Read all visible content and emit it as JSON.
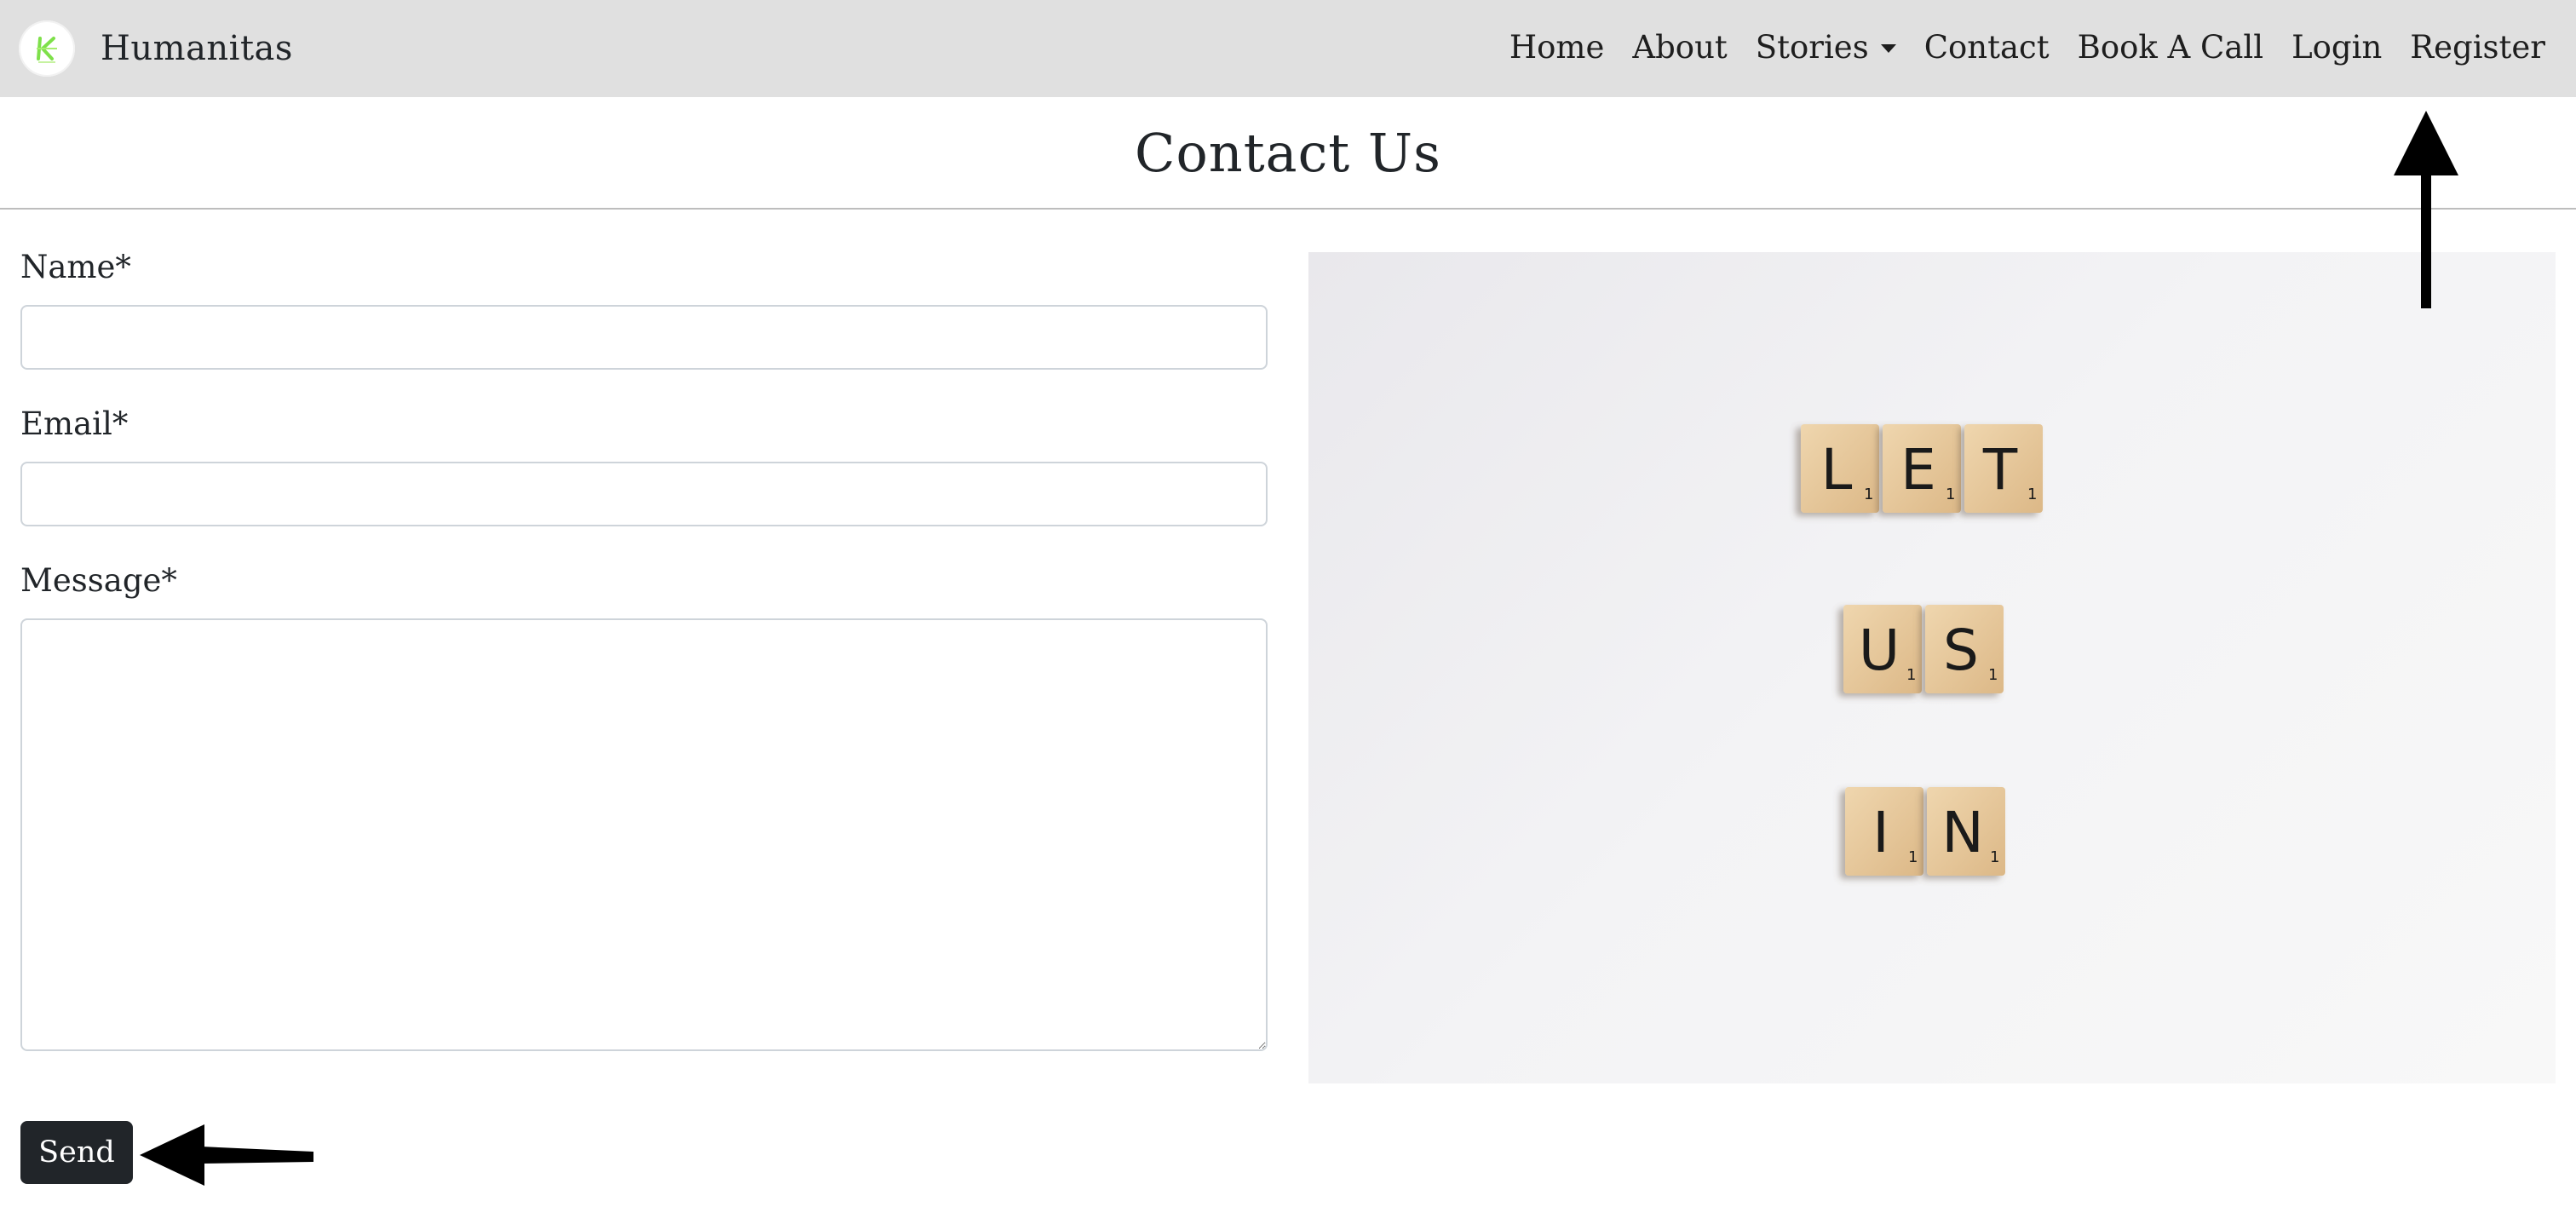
{
  "navbar": {
    "brand_name": "Humanitas",
    "logo_icon": "humanitas-logo-icon",
    "links": [
      {
        "label": "Home"
      },
      {
        "label": "About"
      },
      {
        "label": "Stories",
        "has_dropdown": true
      },
      {
        "label": "Contact"
      },
      {
        "label": "Book A Call"
      },
      {
        "label": "Login"
      },
      {
        "label": "Register"
      }
    ]
  },
  "header": {
    "title": "Contact Us"
  },
  "form": {
    "name_label": "Name*",
    "name_value": "",
    "email_label": "Email*",
    "email_value": "",
    "message_label": "Message*",
    "message_value": "",
    "send_label": "Send"
  },
  "image": {
    "tiles_row1": [
      "L",
      "E",
      "T"
    ],
    "tiles_row2": [
      "U",
      "S"
    ],
    "tiles_row3": [
      "I",
      "N"
    ],
    "tile_value": "1"
  },
  "colors": {
    "navbar_bg": "#e0e0e0",
    "button_bg": "#212529",
    "tile_wood": "#e6c79a"
  }
}
